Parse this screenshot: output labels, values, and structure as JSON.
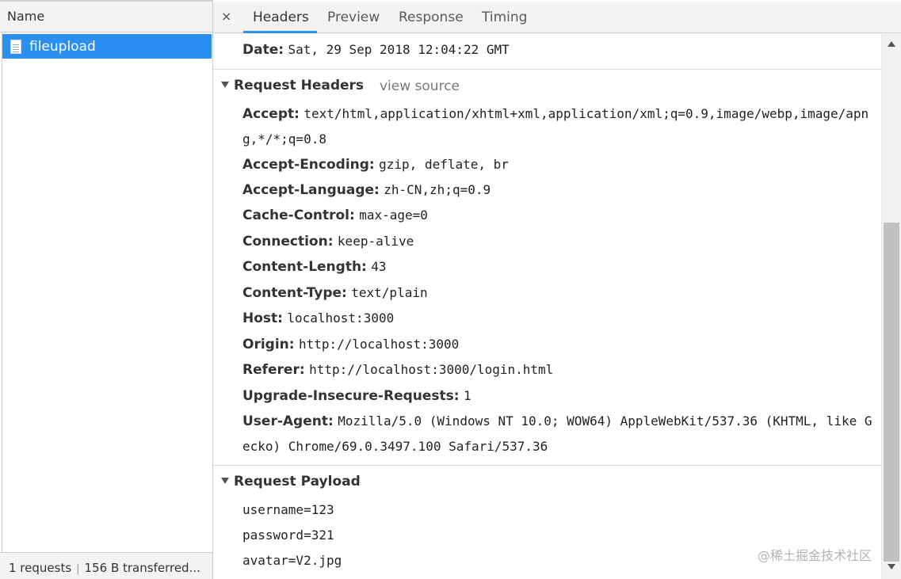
{
  "left_panel": {
    "header": "Name",
    "requests": [
      {
        "name": "fileupload",
        "icon": "document-icon"
      }
    ],
    "footer": {
      "count": "1 requests",
      "separator": "|",
      "transferred": "156 B transferred..."
    }
  },
  "tabs": {
    "close": "×",
    "items": [
      {
        "label": "Headers",
        "active": true
      },
      {
        "label": "Preview",
        "active": false
      },
      {
        "label": "Response",
        "active": false
      },
      {
        "label": "Timing",
        "active": false
      }
    ]
  },
  "response_date": {
    "key": "Date:",
    "value": "Sat, 29 Sep 2018 12:04:22 GMT"
  },
  "request_headers": {
    "title": "Request Headers",
    "view_source": "view source",
    "items": [
      {
        "key": "Accept:",
        "value": "text/html,application/xhtml+xml,application/xml;q=0.9,image/webp,image/apn",
        "cont": "g,*/*;q=0.8"
      },
      {
        "key": "Accept-Encoding:",
        "value": "gzip, deflate, br"
      },
      {
        "key": "Accept-Language:",
        "value": "zh-CN,zh;q=0.9"
      },
      {
        "key": "Cache-Control:",
        "value": "max-age=0"
      },
      {
        "key": "Connection:",
        "value": "keep-alive"
      },
      {
        "key": "Content-Length:",
        "value": "43"
      },
      {
        "key": "Content-Type:",
        "value": "text/plain"
      },
      {
        "key": "Host:",
        "value": "localhost:3000"
      },
      {
        "key": "Origin:",
        "value": "http://localhost:3000"
      },
      {
        "key": "Referer:",
        "value": "http://localhost:3000/login.html"
      },
      {
        "key": "Upgrade-Insecure-Requests:",
        "value": "1"
      },
      {
        "key": "User-Agent:",
        "value": "Mozilla/5.0 (Windows NT 10.0; WOW64) AppleWebKit/537.36 (KHTML, like G",
        "cont": "ecko) Chrome/69.0.3497.100 Safari/537.36"
      }
    ]
  },
  "request_payload": {
    "title": "Request Payload",
    "lines": [
      "username=123",
      "password=321",
      "avatar=V2.jpg"
    ]
  },
  "watermark": "@稀土掘金技术社区",
  "colors": {
    "accent": "#2b8ff0",
    "panel_bg": "#f3f3f3",
    "border": "#cccccc"
  }
}
